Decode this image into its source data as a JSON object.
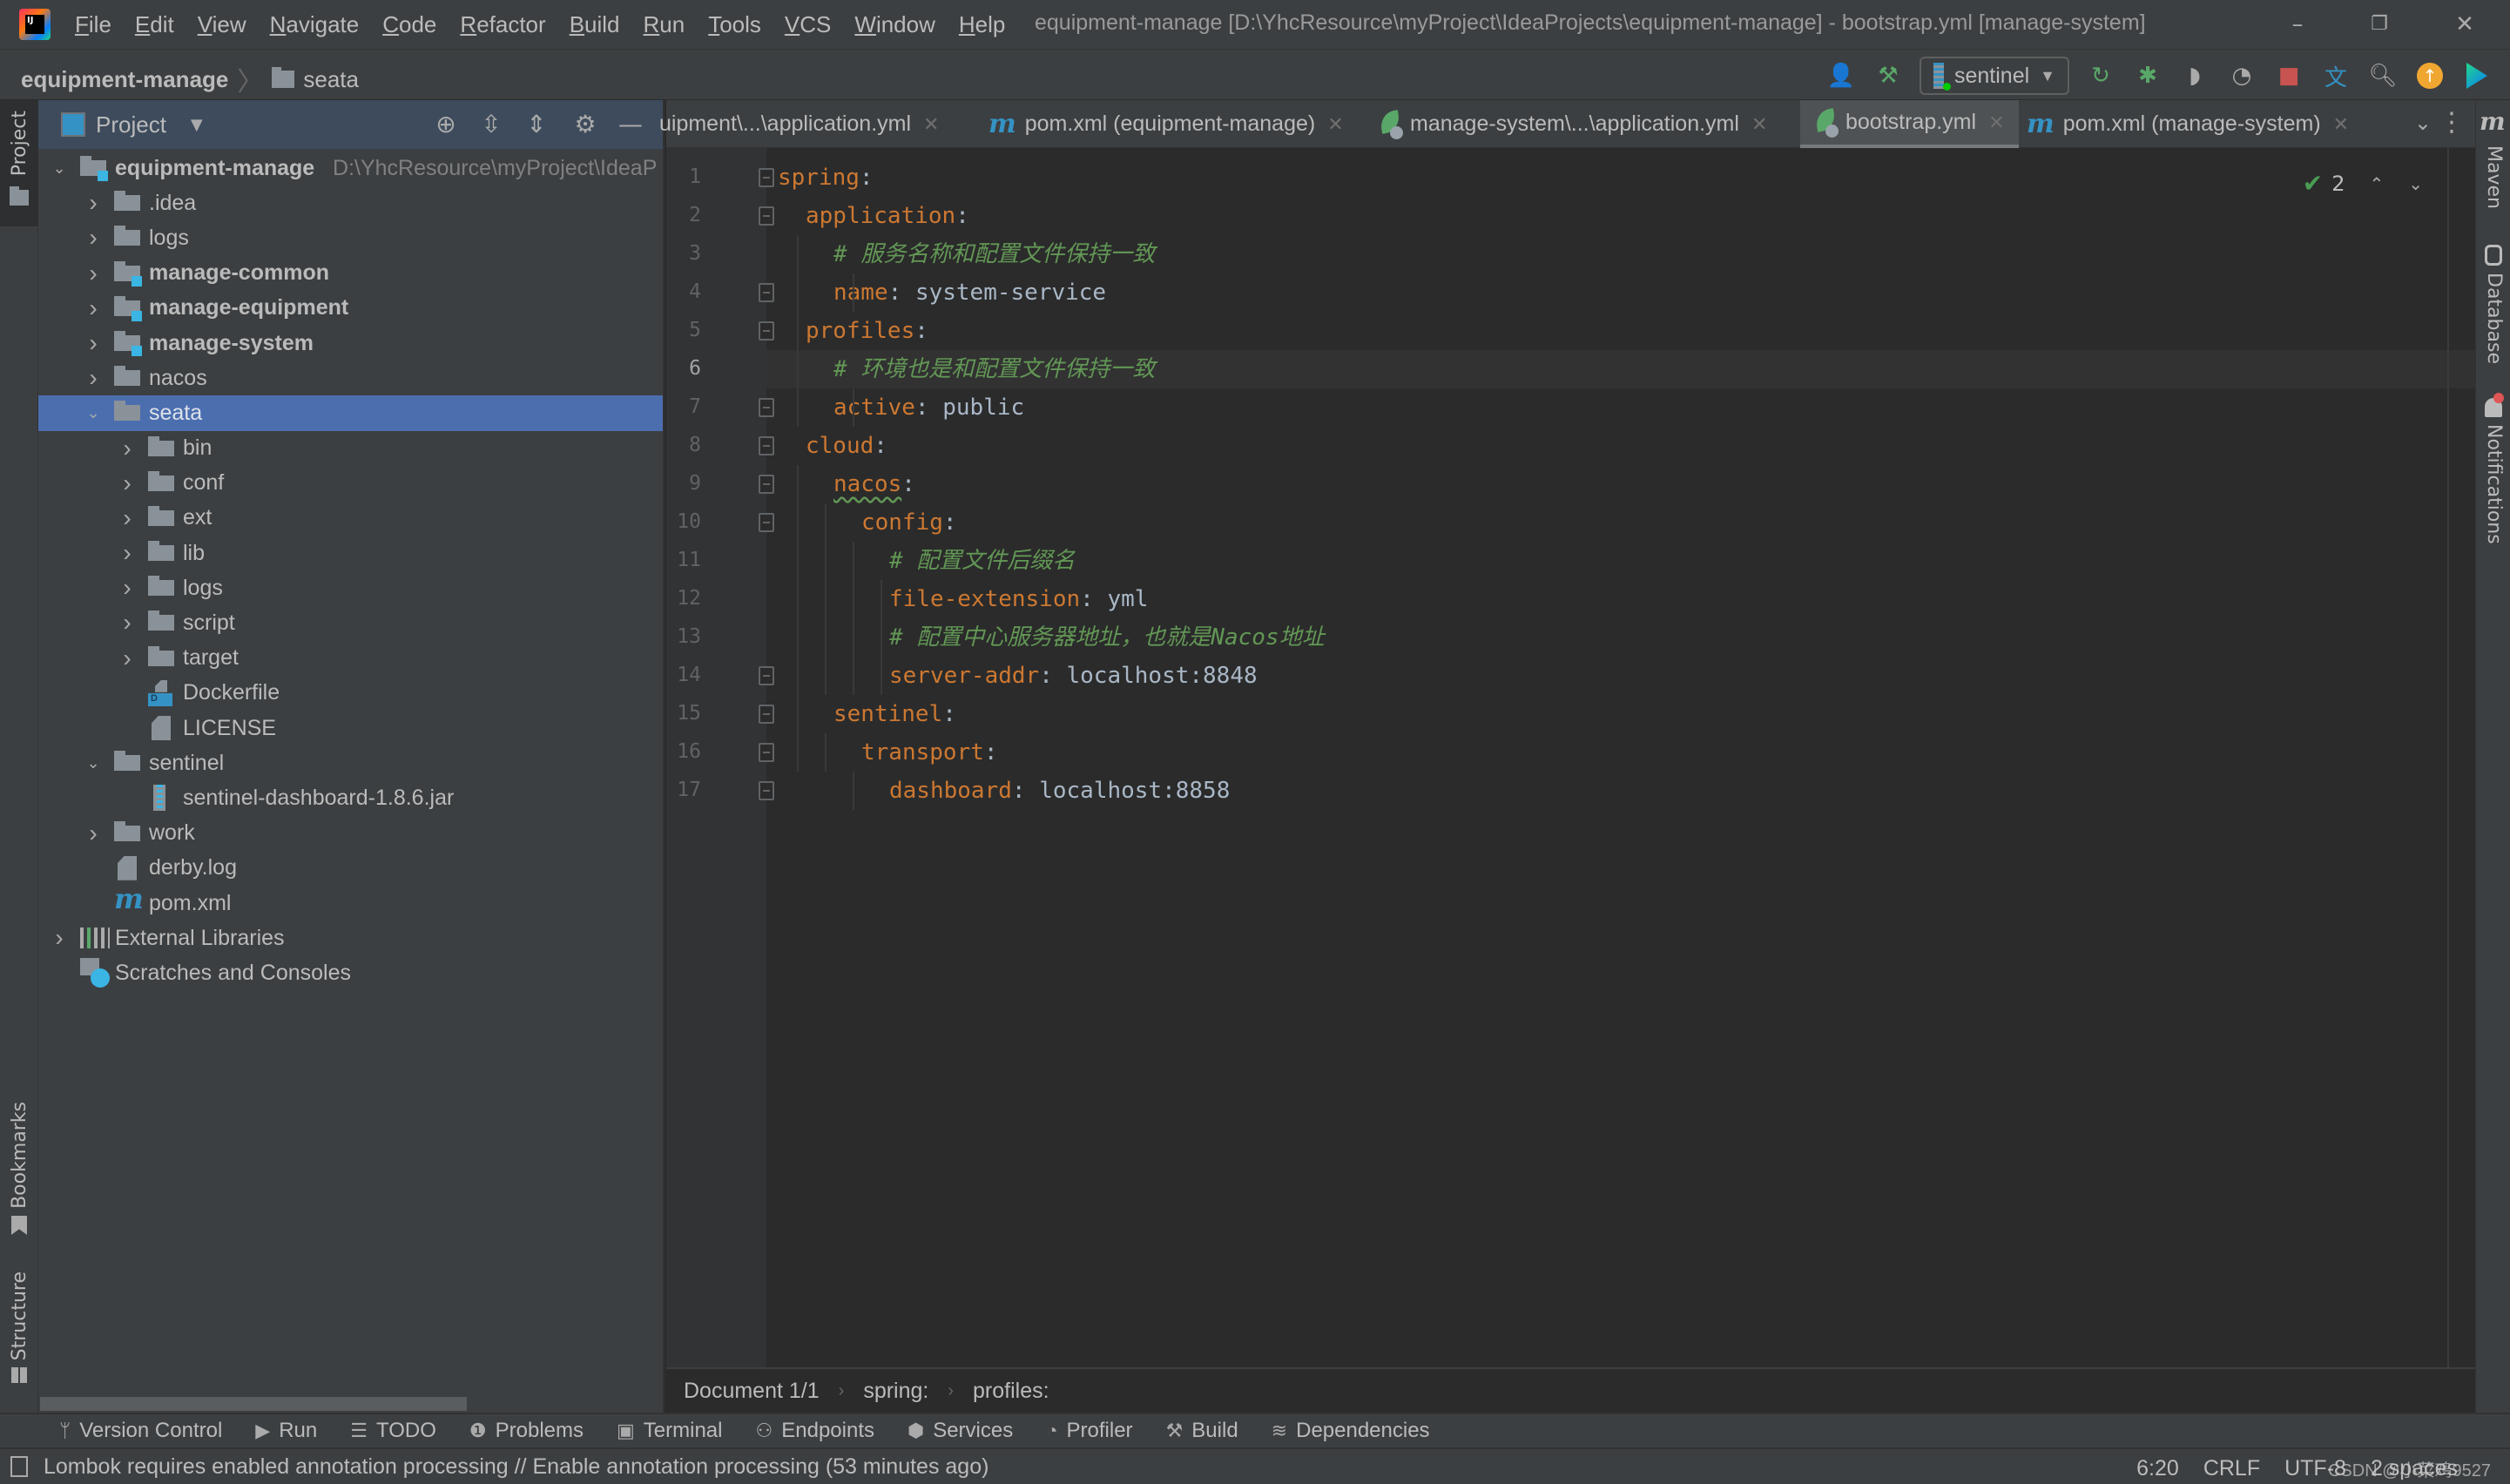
{
  "titlebar": {
    "menu": [
      "File",
      "Edit",
      "View",
      "Navigate",
      "Code",
      "Refactor",
      "Build",
      "Run",
      "Tools",
      "VCS",
      "Window",
      "Help"
    ],
    "window_title": "equipment-manage [D:\\YhcResource\\myProject\\IdeaProjects\\equipment-manage] - bootstrap.yml [manage-system]",
    "minimize": "–",
    "restore": "❐",
    "close": "✕"
  },
  "navbar": {
    "breadcrumb_root": "equipment-manage",
    "breadcrumb_sep": "〉",
    "breadcrumb_folder": "seata",
    "run_config": "sentinel",
    "toolbar_icons": [
      "user-icon",
      "build-hammer-icon",
      "rerun-icon",
      "debug-icon",
      "coverage-icon",
      "profile-icon",
      "stop-icon",
      "translate-icon",
      "search-icon",
      "update-icon",
      "toolbox-icon"
    ]
  },
  "left_stripe": {
    "project": "Project",
    "bookmarks": "Bookmarks",
    "structure": "Structure"
  },
  "project_panel": {
    "title": "Project",
    "tree": [
      {
        "label": "equipment-manage",
        "path": "D:\\YhcResource\\myProject\\IdeaP",
        "icon": "module",
        "depth": 0,
        "expanded": true,
        "bold": true
      },
      {
        "label": ".idea",
        "icon": "folder",
        "depth": 1,
        "expanded": false
      },
      {
        "label": "logs",
        "icon": "folder",
        "depth": 1,
        "expanded": false
      },
      {
        "label": "manage-common",
        "icon": "module",
        "depth": 1,
        "expanded": false,
        "bold": true
      },
      {
        "label": "manage-equipment",
        "icon": "module",
        "depth": 1,
        "expanded": false,
        "bold": true
      },
      {
        "label": "manage-system",
        "icon": "module",
        "depth": 1,
        "expanded": false,
        "bold": true
      },
      {
        "label": "nacos",
        "icon": "folder",
        "depth": 1,
        "expanded": false
      },
      {
        "label": "seata",
        "icon": "folder",
        "depth": 1,
        "expanded": true,
        "selected": true
      },
      {
        "label": "bin",
        "icon": "folder",
        "depth": 2,
        "expanded": false
      },
      {
        "label": "conf",
        "icon": "folder",
        "depth": 2,
        "expanded": false
      },
      {
        "label": "ext",
        "icon": "folder",
        "depth": 2,
        "expanded": false
      },
      {
        "label": "lib",
        "icon": "folder",
        "depth": 2,
        "expanded": false
      },
      {
        "label": "logs",
        "icon": "folder",
        "depth": 2,
        "expanded": false
      },
      {
        "label": "script",
        "icon": "folder",
        "depth": 2,
        "expanded": false
      },
      {
        "label": "target",
        "icon": "folder",
        "depth": 2,
        "expanded": false
      },
      {
        "label": "Dockerfile",
        "icon": "docker",
        "depth": 2
      },
      {
        "label": "LICENSE",
        "icon": "file",
        "depth": 2
      },
      {
        "label": "sentinel",
        "icon": "folder",
        "depth": 1,
        "expanded": true
      },
      {
        "label": "sentinel-dashboard-1.8.6.jar",
        "icon": "jar",
        "depth": 2
      },
      {
        "label": "work",
        "icon": "folder",
        "depth": 1,
        "expanded": false
      },
      {
        "label": "derby.log",
        "icon": "file",
        "depth": 1
      },
      {
        "label": "pom.xml",
        "icon": "maven",
        "depth": 1
      },
      {
        "label": "External Libraries",
        "icon": "libs",
        "depth": 0,
        "expanded": false
      },
      {
        "label": "Scratches and Consoles",
        "icon": "scratch",
        "depth": 0
      }
    ]
  },
  "editor_tabs": [
    {
      "label": "uipment\\...\\application.yml",
      "icon": "spring",
      "active": false
    },
    {
      "label": "pom.xml (equipment-manage)",
      "icon": "maven",
      "active": false
    },
    {
      "label": "manage-system\\...\\application.yml",
      "icon": "spring",
      "active": false
    },
    {
      "label": "bootstrap.yml",
      "icon": "spring",
      "active": true
    },
    {
      "label": "pom.xml (manage-system)",
      "icon": "maven",
      "active": false
    }
  ],
  "editor": {
    "inspection_count": "2",
    "current_line": 6,
    "lines": [
      {
        "n": "1",
        "indent": 0,
        "key": "spring",
        "value": "",
        "comment": ""
      },
      {
        "n": "2",
        "indent": 1,
        "key": "application",
        "value": "",
        "comment": ""
      },
      {
        "n": "3",
        "indent": 2,
        "key": "",
        "value": "",
        "comment": "# 服务名称和配置文件保持一致"
      },
      {
        "n": "4",
        "indent": 2,
        "key": "name",
        "value": "system-service",
        "comment": ""
      },
      {
        "n": "5",
        "indent": 1,
        "key": "profiles",
        "value": "",
        "comment": ""
      },
      {
        "n": "6",
        "indent": 2,
        "key": "",
        "value": "",
        "comment": "# 环境也是和配置文件保持一致"
      },
      {
        "n": "7",
        "indent": 2,
        "key": "active",
        "value": "public",
        "comment": ""
      },
      {
        "n": "8",
        "indent": 1,
        "key": "cloud",
        "value": "",
        "comment": ""
      },
      {
        "n": "9",
        "indent": 2,
        "key": "nacos",
        "value": "",
        "comment": "",
        "squiggly": true
      },
      {
        "n": "10",
        "indent": 3,
        "key": "config",
        "value": "",
        "comment": ""
      },
      {
        "n": "11",
        "indent": 4,
        "key": "",
        "value": "",
        "comment": "# 配置文件后缀名"
      },
      {
        "n": "12",
        "indent": 4,
        "key": "file-extension",
        "value": "yml",
        "comment": ""
      },
      {
        "n": "13",
        "indent": 4,
        "key": "",
        "value": "",
        "comment": "# 配置中心服务器地址，也就是Nacos地址"
      },
      {
        "n": "14",
        "indent": 4,
        "key": "server-addr",
        "value": "localhost:8848",
        "comment": ""
      },
      {
        "n": "15",
        "indent": 2,
        "key": "sentinel",
        "value": "",
        "comment": ""
      },
      {
        "n": "16",
        "indent": 3,
        "key": "transport",
        "value": "",
        "comment": ""
      },
      {
        "n": "17",
        "indent": 4,
        "key": "dashboard",
        "value": "localhost:8858",
        "comment": ""
      }
    ]
  },
  "editor_breadcrumb": [
    "Document 1/1",
    "spring:",
    "profiles:"
  ],
  "bottom_tools": [
    {
      "label": "Version Control",
      "icon": "version-control-icon",
      "glyph": "ᛘ"
    },
    {
      "label": "Run",
      "icon": "run-icon",
      "glyph": "▶"
    },
    {
      "label": "TODO",
      "icon": "todo-icon",
      "glyph": "☰"
    },
    {
      "label": "Problems",
      "icon": "problems-icon",
      "glyph": "❶"
    },
    {
      "label": "Terminal",
      "icon": "terminal-icon",
      "glyph": "▣"
    },
    {
      "label": "Endpoints",
      "icon": "endpoints-icon",
      "glyph": "⚇"
    },
    {
      "label": "Services",
      "icon": "services-icon",
      "glyph": "⬢"
    },
    {
      "label": "Profiler",
      "icon": "profiler-icon",
      "glyph": "◔"
    },
    {
      "label": "Build",
      "icon": "build-icon",
      "glyph": "⚒"
    },
    {
      "label": "Dependencies",
      "icon": "dependencies-icon",
      "glyph": "≋"
    }
  ],
  "statusbar": {
    "message": "Lombok requires enabled annotation processing // Enable annotation processing (53 minutes ago)",
    "position": "6:20",
    "line_sep": "CRLF",
    "encoding": "UTF-8",
    "indent": "2 spaces",
    "watermark": "CSDN @小菜鸡9527"
  },
  "right_stripe": {
    "maven": "Maven",
    "database": "Database",
    "notifications": "Notifications"
  },
  "colors": {
    "key": "#cc7832",
    "comment": "#629755",
    "value": "#a9b7c6",
    "selection": "#4b6eaf",
    "background": "#2b2b2b",
    "panel": "#3c3f41"
  }
}
